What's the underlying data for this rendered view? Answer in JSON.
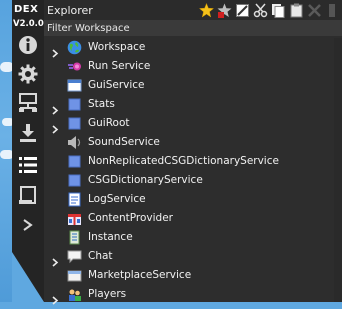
{
  "dex": {
    "title": "DEX",
    "version": "V2.0.0"
  },
  "explorer": {
    "title": "Explorer",
    "filter_placeholder": "Filter Workspace",
    "tree": [
      {
        "label": "Workspace",
        "icon": "globe-icon",
        "expandable": true
      },
      {
        "label": "Run Service",
        "icon": "run-service-icon",
        "expandable": false
      },
      {
        "label": "GuiService",
        "icon": "window-icon",
        "expandable": false
      },
      {
        "label": "Stats",
        "icon": "blue-square-icon",
        "expandable": true
      },
      {
        "label": "GuiRoot",
        "icon": "blue-square-icon",
        "expandable": true
      },
      {
        "label": "SoundService",
        "icon": "speaker-icon",
        "expandable": false
      },
      {
        "label": "NonReplicatedCSGDictionaryService",
        "icon": "blue-square-icon",
        "expandable": false
      },
      {
        "label": "CSGDictionaryService",
        "icon": "blue-square-icon",
        "expandable": false
      },
      {
        "label": "LogService",
        "icon": "log-icon",
        "expandable": false
      },
      {
        "label": "ContentProvider",
        "icon": "gift-icon",
        "expandable": false
      },
      {
        "label": "Instance",
        "icon": "script-icon",
        "expandable": false
      },
      {
        "label": "Chat",
        "icon": "chat-bubble-icon",
        "expandable": true
      },
      {
        "label": "MarketplaceService",
        "icon": "marketplace-icon",
        "expandable": false
      },
      {
        "label": "Players",
        "icon": "players-icon",
        "expandable": true
      }
    ]
  }
}
